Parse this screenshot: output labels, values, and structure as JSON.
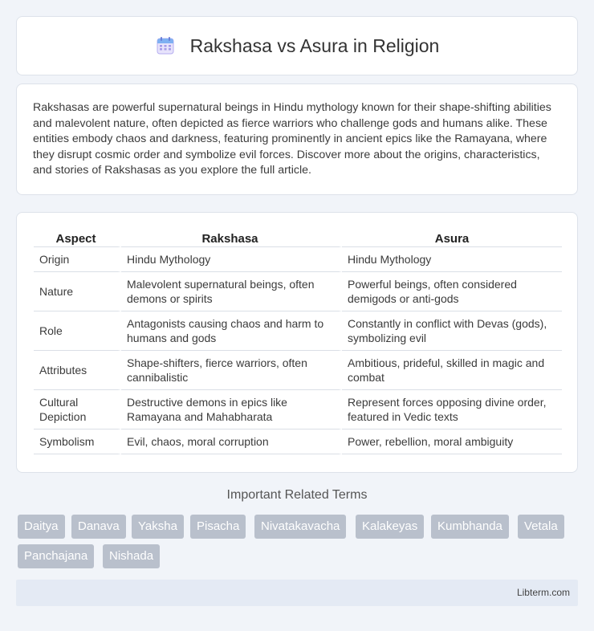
{
  "header": {
    "icon": "calendar-icon",
    "title": "Rakshasa vs Asura in Religion"
  },
  "intro": {
    "text": "Rakshasas are powerful supernatural beings in Hindu mythology known for their shape-shifting abilities and malevolent nature, often depicted as fierce warriors who challenge gods and humans alike. These entities embody chaos and darkness, featuring prominently in ancient epics like the Ramayana, where they disrupt cosmic order and symbolize evil forces. Discover more about the origins, characteristics, and stories of Rakshasas as you explore the full article."
  },
  "table": {
    "headers": [
      "Aspect",
      "Rakshasa",
      "Asura"
    ],
    "rows": [
      [
        "Origin",
        "Hindu Mythology",
        "Hindu Mythology"
      ],
      [
        "Nature",
        "Malevolent supernatural beings, often demons or spirits",
        "Powerful beings, often considered demigods or anti-gods"
      ],
      [
        "Role",
        "Antagonists causing chaos and harm to humans and gods",
        "Constantly in conflict with Devas (gods), symbolizing evil"
      ],
      [
        "Attributes",
        "Shape-shifters, fierce warriors, often cannibalistic",
        "Ambitious, prideful, skilled in magic and combat"
      ],
      [
        "Cultural Depiction",
        "Destructive demons in epics like Ramayana and Mahabharata",
        "Represent forces opposing divine order, featured in Vedic texts"
      ],
      [
        "Symbolism",
        "Evil, chaos, moral corruption",
        "Power, rebellion, moral ambiguity"
      ]
    ]
  },
  "related": {
    "title": "Important Related Terms",
    "tags": [
      "Daitya",
      "Danava",
      "Yaksha",
      "Pisacha",
      "Nivatakavacha",
      "Kalakeyas",
      "Kumbhanda",
      "Vetala",
      "Panchajana",
      "Nishada"
    ]
  },
  "footer": {
    "text": "Libterm.com"
  },
  "colors": {
    "tag_bg": "#b9c0cc",
    "footer_bg": "#e4eaf4",
    "page_bg": "#f1f4f9"
  }
}
